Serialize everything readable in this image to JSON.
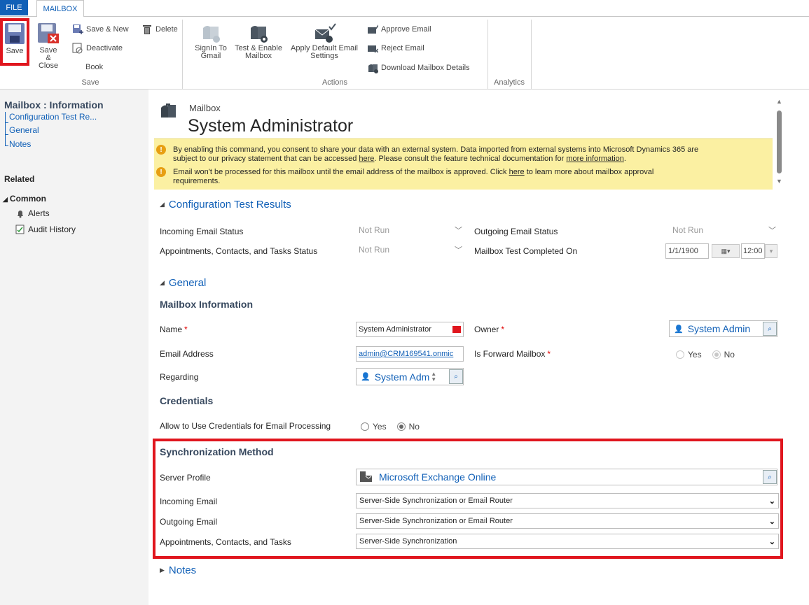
{
  "tabs": {
    "file": "FILE",
    "mailbox": "MAILBOX"
  },
  "ribbon": {
    "save": "Save",
    "save_close": [
      "Save &",
      "Close"
    ],
    "save_new": "Save & New",
    "deactivate": "Deactivate",
    "delete": "Delete",
    "book": "Book",
    "group_save": "Save",
    "signin": [
      "SignIn To",
      "Gmail"
    ],
    "test_enable": [
      "Test & Enable",
      "Mailbox"
    ],
    "apply_default": [
      "Apply Default Email",
      "Settings"
    ],
    "approve_email": "Approve Email",
    "reject_email": "Reject Email",
    "download_details": "Download Mailbox Details",
    "group_actions": "Actions",
    "group_analytics": "Analytics"
  },
  "nav": {
    "title": "Mailbox : Information",
    "links": [
      "Configuration Test Re...",
      "General",
      "Notes"
    ],
    "related": "Related",
    "common": "Common",
    "items": [
      "Alerts",
      "Audit History"
    ]
  },
  "header": {
    "entity": "Mailbox",
    "title": "System Administrator"
  },
  "notices": {
    "n1_a": "By enabling this command, you consent to share your data with an external system. Data imported from external systems into Microsoft Dynamics 365 are",
    "n1_b": "subject to our privacy statement that can be accessed ",
    "n1_here": "here",
    "n1_c": ". Please consult the feature technical documentation for ",
    "n1_more": "more information",
    "n1_d": ".",
    "n2_a": "Email won't be processed for this mailbox until the email address of the mailbox is approved. Click ",
    "n2_here": "here",
    "n2_b": " to learn more about mailbox approval",
    "n2_c": "requirements."
  },
  "config": {
    "heading": "Configuration Test Results",
    "incoming_label": "Incoming Email Status",
    "incoming_value": "Not Run",
    "outgoing_label": "Outgoing Email Status",
    "outgoing_value": "Not Run",
    "appt_label": "Appointments, Contacts, and Tasks Status",
    "appt_value": "Not Run",
    "completed_label": "Mailbox Test Completed On",
    "completed_date": "1/1/1900",
    "completed_time": "12:00"
  },
  "general": {
    "heading": "General",
    "mailbox_info": "Mailbox Information",
    "name_label": "Name",
    "name_value": "System Administrator",
    "owner_label": "Owner",
    "owner_value": "System Admin",
    "email_label": "Email Address",
    "email_value": "admin@CRM169541.onmic",
    "forward_label": "Is Forward Mailbox",
    "yes": "Yes",
    "no": "No",
    "regarding_label": "Regarding",
    "regarding_value": "System Adm",
    "credentials": "Credentials",
    "allow_label": "Allow to Use Credentials for Email Processing"
  },
  "sync": {
    "heading": "Synchronization Method",
    "server_label": "Server Profile",
    "server_value": "Microsoft Exchange Online",
    "incoming_label": "Incoming Email",
    "incoming_value": "Server-Side Synchronization or Email Router",
    "outgoing_label": "Outgoing Email",
    "outgoing_value": "Server-Side Synchronization or Email Router",
    "appt_label": "Appointments, Contacts, and Tasks",
    "appt_value": "Server-Side Synchronization"
  },
  "notes": {
    "heading": "Notes"
  },
  "colors": {
    "accent": "#1160b7",
    "highlight": "#e0161e",
    "notice_bg": "#fbf0a2",
    "warning": "#e79f12"
  }
}
